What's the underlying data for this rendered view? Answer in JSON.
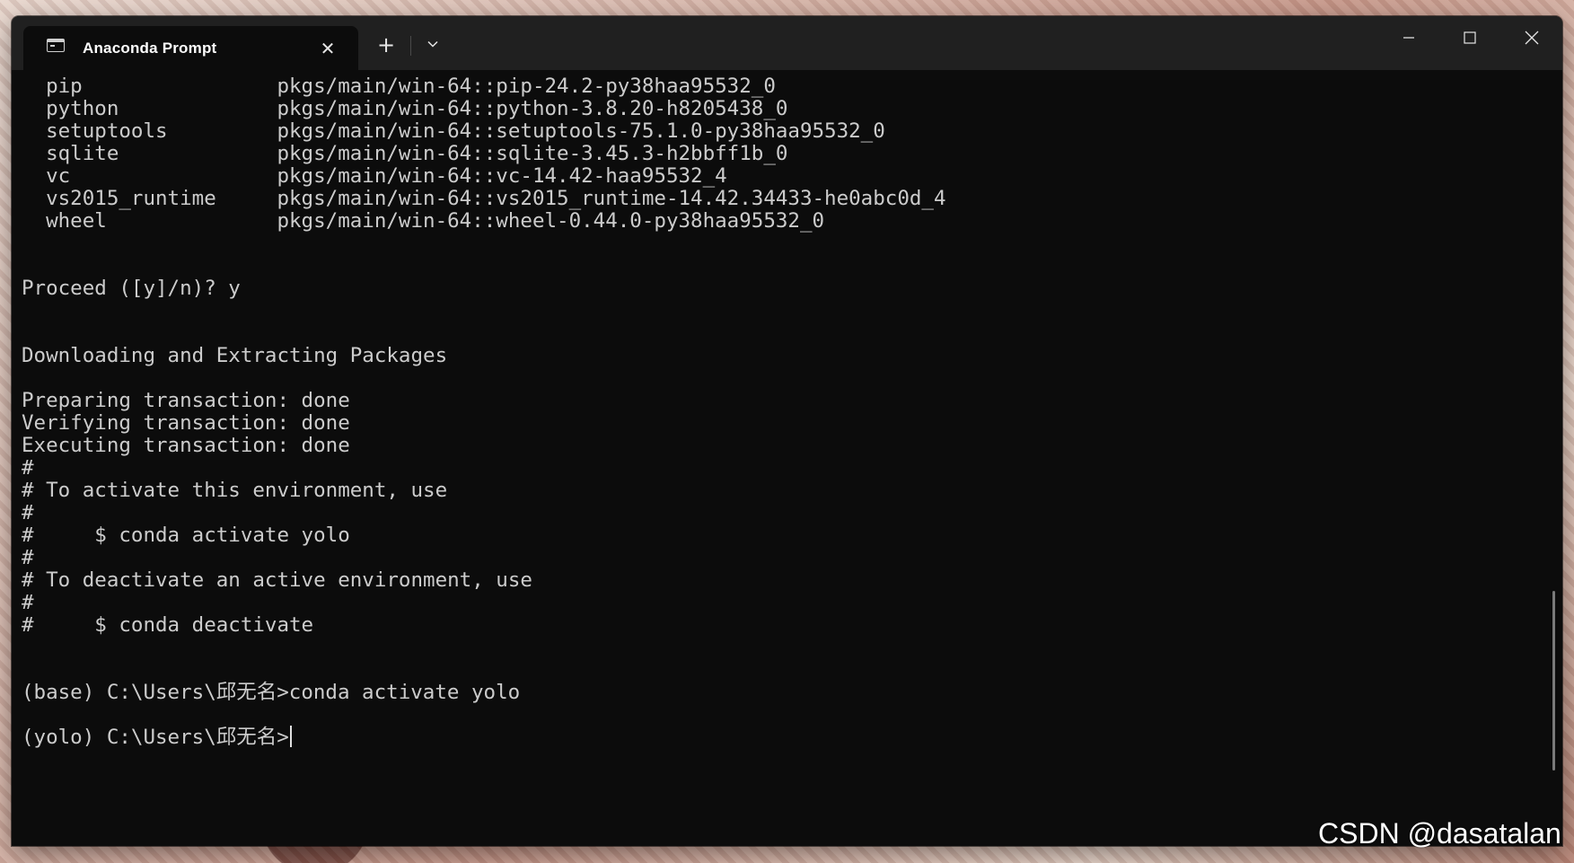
{
  "window": {
    "tab_title": "Anaconda Prompt",
    "tab_icon": "terminal-icon",
    "new_tab_label": "+",
    "tab_close_label": "✕"
  },
  "terminal": {
    "lines": [
      "  pip                pkgs/main/win-64::pip-24.2-py38haa95532_0",
      "  python             pkgs/main/win-64::python-3.8.20-h8205438_0",
      "  setuptools         pkgs/main/win-64::setuptools-75.1.0-py38haa95532_0",
      "  sqlite             pkgs/main/win-64::sqlite-3.45.3-h2bbff1b_0",
      "  vc                 pkgs/main/win-64::vc-14.42-haa95532_4",
      "  vs2015_runtime     pkgs/main/win-64::vs2015_runtime-14.42.34433-he0abc0d_4",
      "  wheel              pkgs/main/win-64::wheel-0.44.0-py38haa95532_0",
      "",
      "",
      "Proceed ([y]/n)? y",
      "",
      "",
      "Downloading and Extracting Packages",
      "",
      "Preparing transaction: done",
      "Verifying transaction: done",
      "Executing transaction: done",
      "#",
      "# To activate this environment, use",
      "#",
      "#     $ conda activate yolo",
      "#",
      "# To deactivate an active environment, use",
      "#",
      "#     $ conda deactivate",
      "",
      "",
      "(base) C:\\Users\\邱无名>conda activate yolo",
      "",
      "(yolo) C:\\Users\\邱无名>"
    ]
  },
  "watermark": "CSDN @dasatalan",
  "colors": {
    "terminal_bg": "#0c0c0c",
    "titlebar_bg": "#202020",
    "text": "#cccccc"
  }
}
